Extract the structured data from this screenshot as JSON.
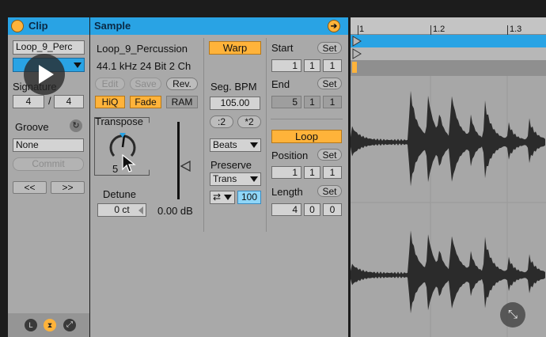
{
  "clip": {
    "title": "Clip",
    "name_value": "Loop_9_Perc",
    "signature_label": "Signature",
    "sig_num": "4",
    "sig_sep": "/",
    "sig_den": "4",
    "groove_label": "Groove",
    "groove_value": "None",
    "commit_label": "Commit",
    "nudge_left": "<<",
    "nudge_right": ">>",
    "tab_l": "L"
  },
  "sample": {
    "title": "Sample",
    "name": "Loop_9_Percussion",
    "info": "44.1 kHz 24 Bit 2 Ch",
    "edit_label": "Edit",
    "save_label": "Save",
    "rev_label": "Rev.",
    "hiq_label": "HiQ",
    "fade_label": "Fade",
    "ram_label": "RAM",
    "transpose_label": "Transpose",
    "transpose_value": "5",
    "detune_label": "Detune",
    "detune_value": "0 ct",
    "gain_value": "0.00 dB"
  },
  "warp": {
    "warp_label": "Warp",
    "seg_bpm_label": "Seg. BPM",
    "seg_bpm_value": "105.00",
    "half_label": ":2",
    "double_label": "*2",
    "mode_value": "Beats",
    "preserve_label": "Preserve",
    "preserve_value": "Trans",
    "loop_mode_value": "⇄",
    "envelope_value": "100"
  },
  "loop": {
    "start_label": "Start",
    "set_label": "Set",
    "start_bar": "1",
    "start_beat": "1",
    "start_six": "1",
    "end_label": "End",
    "end_bar": "5",
    "end_beat": "1",
    "end_six": "1",
    "loop_label": "Loop",
    "position_label": "Position",
    "pos_bar": "1",
    "pos_beat": "1",
    "pos_six": "1",
    "length_label": "Length",
    "len_bar": "4",
    "len_beat": "0",
    "len_six": "0"
  },
  "ruler": {
    "marks": [
      "1",
      "1.2",
      "1.3"
    ]
  },
  "colors": {
    "accent": "#29a3e4",
    "highlight": "#ffb33a",
    "panel": "#a9a9a9",
    "waveform": "#2b2b2b"
  }
}
